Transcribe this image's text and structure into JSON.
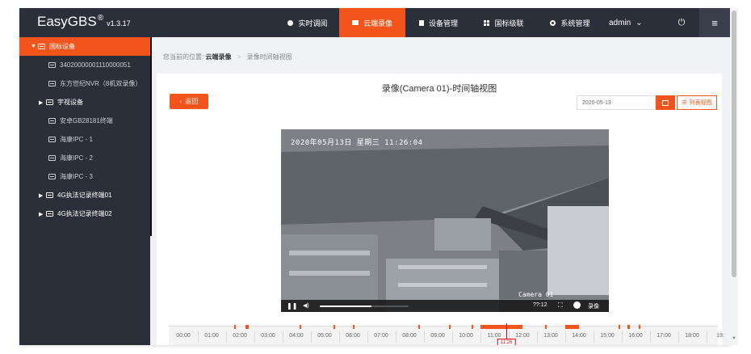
{
  "app": {
    "brand": "EasyGBS",
    "brand_mark": "®",
    "version": "v1.3.17"
  },
  "nav": [
    {
      "label": "实时调阅",
      "icon": "play-circle-icon",
      "active": false
    },
    {
      "label": "云端录像",
      "icon": "video-camera-icon",
      "active": true
    },
    {
      "label": "设备管理",
      "icon": "device-icon",
      "active": false
    },
    {
      "label": "国标级联",
      "icon": "cascade-grid-icon",
      "active": false
    },
    {
      "label": "系统管理",
      "icon": "gear-icon",
      "active": false
    }
  ],
  "user": {
    "name": "admin",
    "power_icon": "⏻",
    "menu_icon": "≡"
  },
  "sidebar": {
    "root": "国标设备",
    "items": [
      {
        "label": "34020000001110000051",
        "type": "child"
      },
      {
        "label": "东方世纪NVR（8机双录像）",
        "type": "child"
      },
      {
        "label": "宇视设备",
        "type": "group"
      },
      {
        "label": "安卓GB28181终端",
        "type": "child"
      },
      {
        "label": "海康IPC - 1",
        "type": "child"
      },
      {
        "label": "海康IPC - 2",
        "type": "child"
      },
      {
        "label": "海康IPC - 3",
        "type": "child"
      },
      {
        "label": "4G执法记录终端01",
        "type": "group"
      },
      {
        "label": "4G执法记录终端02",
        "type": "group"
      }
    ]
  },
  "breadcrumb": {
    "prefix": "您当前的位置:",
    "current": "云端录像",
    "sep": ">",
    "page": "录像时间轴视图"
  },
  "main": {
    "title": "录像(Camera 01)-时间轴视图",
    "back_label": "返回",
    "date_value": "2020-05-13",
    "list_view_label": "列表视图"
  },
  "video": {
    "osd_text": "2020年05月13日  星期三  11:26:04",
    "camera_label": "Camera 01",
    "time": "??:12",
    "record_label": "录像",
    "progress": 0.58
  },
  "timeline": {
    "hours": [
      "00:00",
      "01:00",
      "02:00",
      "03:00",
      "04:00",
      "05:00",
      "06:00",
      "07:00",
      "08:00",
      "09:00",
      "10:00",
      "11:00",
      "12:00",
      "13:00",
      "14:00",
      "15:00",
      "16:00",
      "17:00",
      "18:00",
      "19:"
    ],
    "cursor_hour": 11.43,
    "cursor_label": "11:26",
    "records": [
      [
        1.8,
        1.85
      ],
      [
        2.2,
        2.3
      ],
      [
        4.1,
        4.15
      ],
      [
        5.3,
        5.35
      ],
      [
        6.0,
        6.05
      ],
      [
        8.3,
        8.35
      ],
      [
        9.4,
        9.45
      ],
      [
        10.2,
        10.25
      ],
      [
        10.5,
        12.0
      ],
      [
        12.8,
        12.85
      ],
      [
        13.5,
        14.0
      ],
      [
        15.4,
        15.45
      ],
      [
        15.7,
        15.8
      ],
      [
        16.1,
        16.15
      ]
    ],
    "accent": "#f2541b",
    "cursor_color": "#e60012"
  }
}
